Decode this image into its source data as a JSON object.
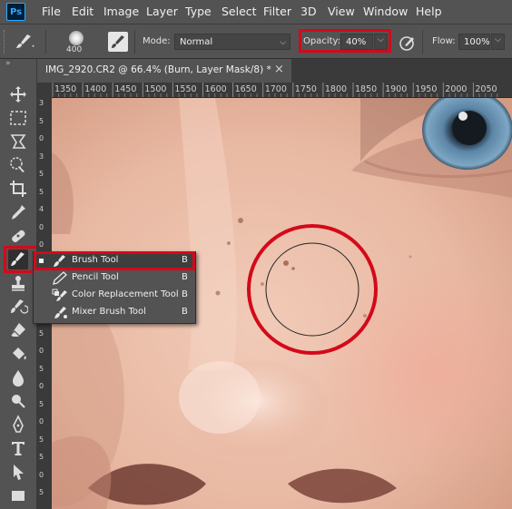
{
  "app": {
    "logo": "Ps"
  },
  "menu": [
    "File",
    "Edit",
    "Image",
    "Layer",
    "Type",
    "Select",
    "Filter",
    "3D",
    "View",
    "Window",
    "Help"
  ],
  "options": {
    "brush_size": "400",
    "mode_label": "Mode:",
    "mode_value": "Normal",
    "opacity_label": "Opacity:",
    "opacity_value": "40%",
    "flow_label": "Flow:",
    "flow_value": "100%"
  },
  "document": {
    "tab_title": "IMG_2920.CR2 @ 66.4% (Burn, Layer Mask/8) *",
    "close_glyph": "×"
  },
  "ruler": {
    "top_ticks": [
      "1350",
      "1400",
      "1450",
      "1500",
      "1550",
      "1600",
      "1650",
      "1700",
      "1750",
      "1800",
      "1850",
      "1900",
      "1950",
      "2000",
      "2050"
    ],
    "left_ticks": [
      "3",
      "5",
      "0",
      "3",
      "5",
      "5",
      "4",
      "0",
      "0",
      "4",
      "5",
      "0",
      "4",
      "5",
      "0",
      "5",
      "0",
      "5",
      "0",
      "5",
      "5",
      "0",
      "5"
    ]
  },
  "flyout": {
    "items": [
      {
        "label": "Brush Tool",
        "key": "B",
        "icon": "brush-icon"
      },
      {
        "label": "Pencil Tool",
        "key": "B",
        "icon": "pencil-icon"
      },
      {
        "label": "Color Replacement Tool",
        "key": "B",
        "icon": "color-replacement-icon"
      },
      {
        "label": "Mixer Brush Tool",
        "key": "B",
        "icon": "mixer-brush-icon"
      }
    ]
  },
  "colors": {
    "highlight": "#d4091a",
    "panel": "#535353",
    "dark": "#3a3a3a"
  }
}
